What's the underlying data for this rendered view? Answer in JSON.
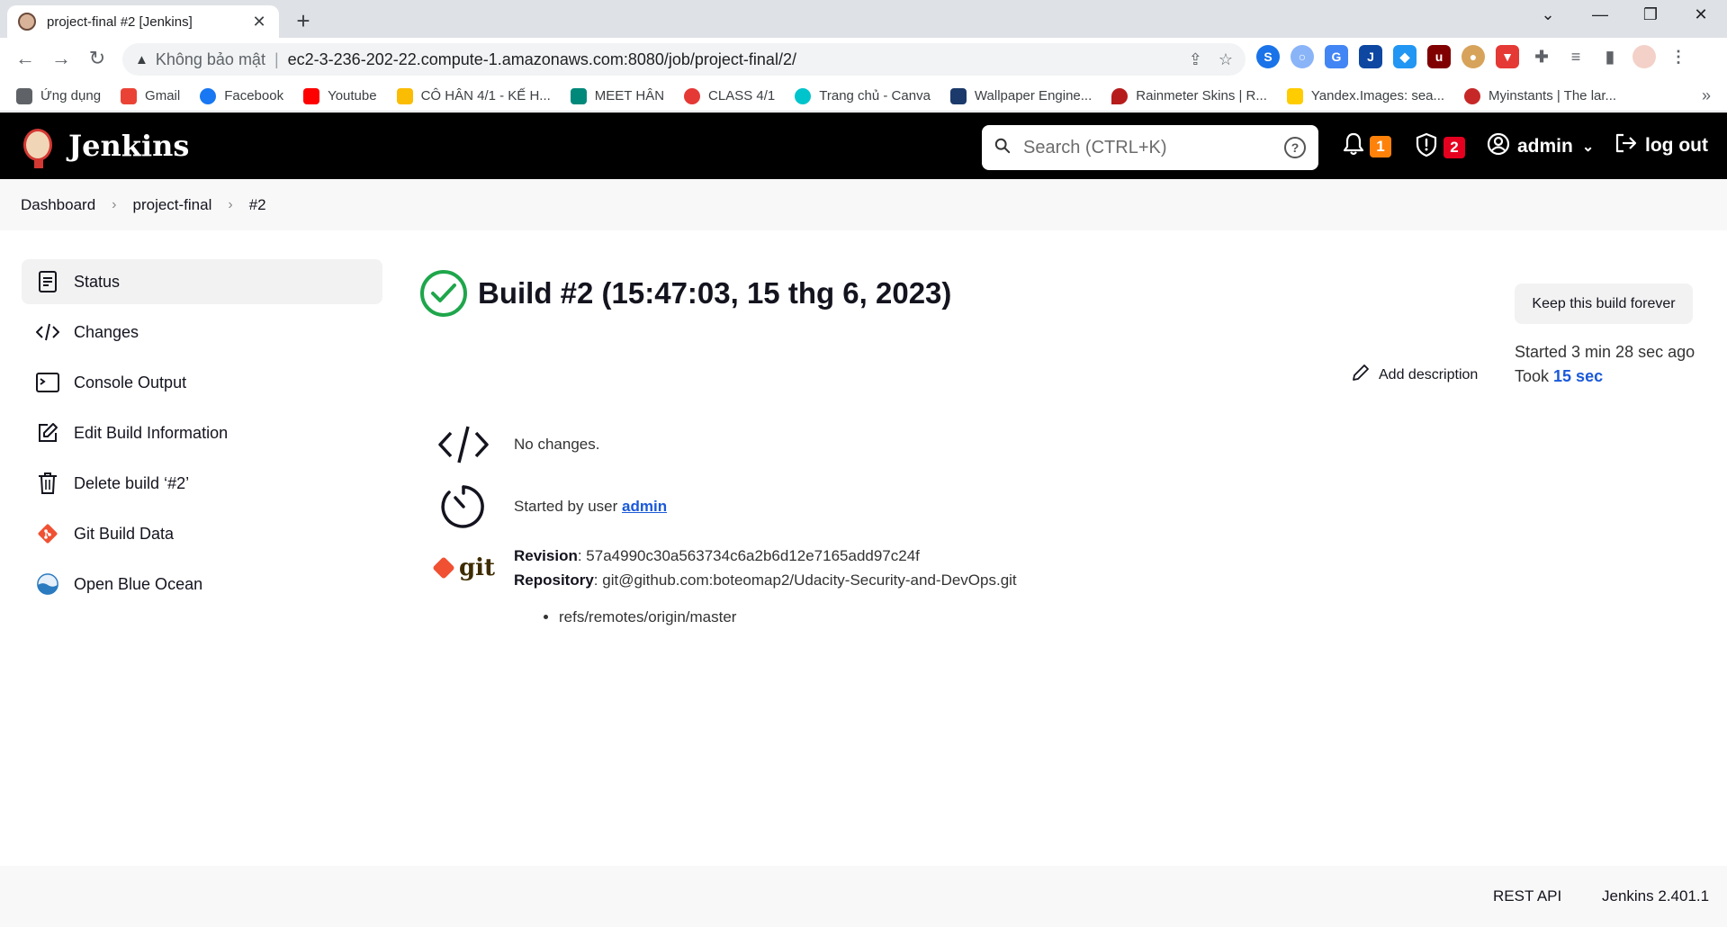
{
  "browser": {
    "tab_title": "project-final #2 [Jenkins]",
    "insecure_label": "Không bảo mật",
    "url": "ec2-3-236-202-22.compute-1.amazonaws.com:8080/job/project-final/2/",
    "bookmarks": [
      {
        "label": "Ứng dụng",
        "color": "#5f6368"
      },
      {
        "label": "Gmail",
        "color": "#ea4335"
      },
      {
        "label": "Facebook",
        "color": "#1877f2"
      },
      {
        "label": "Youtube",
        "color": "#ff0000"
      },
      {
        "label": "CÔ HÂN 4/1 - KẾ H...",
        "color": "#fbbc04"
      },
      {
        "label": "MEET HÂN",
        "color": "#00897b"
      },
      {
        "label": "CLASS 4/1",
        "color": "#e53935"
      },
      {
        "label": "Trang chủ - Canva",
        "color": "#00c4cc"
      },
      {
        "label": "Wallpaper Engine...",
        "color": "#1b3a6b"
      },
      {
        "label": "Rainmeter Skins | R...",
        "color": "#b71c1c"
      },
      {
        "label": "Yandex.Images: sea...",
        "color": "#ffcc00"
      },
      {
        "label": "Myinstants | The lar...",
        "color": "#c62828"
      }
    ]
  },
  "header": {
    "logo_text": "Jenkins",
    "search_placeholder": "Search (CTRL+K)",
    "notifications_count": "1",
    "security_count": "2",
    "user": "admin",
    "logout": "log out",
    "colors": {
      "notification_badge": "#fe820a",
      "security_badge": "#e6001f"
    }
  },
  "breadcrumbs": [
    "Dashboard",
    "project-final",
    "#2"
  ],
  "sidepanel": [
    {
      "label": "Status",
      "icon": "status-icon"
    },
    {
      "label": "Changes",
      "icon": "code-icon"
    },
    {
      "label": "Console Output",
      "icon": "terminal-icon"
    },
    {
      "label": "Edit Build Information",
      "icon": "edit-icon"
    },
    {
      "label": "Delete build ‘#2’",
      "icon": "trash-icon"
    },
    {
      "label": "Git Build Data",
      "icon": "git-icon"
    },
    {
      "label": "Open Blue Ocean",
      "icon": "blue-ocean-icon"
    }
  ],
  "build": {
    "title": "Build #2 (15:47:03, 15 thg 6, 2023)",
    "keep_button": "Keep this build forever",
    "started": "Started 3 min 28 sec ago",
    "took_prefix": "Took ",
    "took_value": "15 sec",
    "add_description": "Add description",
    "no_changes": "No changes.",
    "started_by_prefix": "Started by user ",
    "started_by_user": "admin",
    "revision_label": "Revision",
    "revision_value": ": 57a4990c30a563734c6a2b6d12e7165add97c24f",
    "repository_label": "Repository",
    "repository_value": ": git@github.com:boteomap2/Udacity-Security-and-DevOps.git",
    "ref": "refs/remotes/origin/master",
    "git_logo_text": "git",
    "success_color": "#1ea64b"
  },
  "footer": {
    "rest_api": "REST API",
    "version": "Jenkins 2.401.1"
  }
}
